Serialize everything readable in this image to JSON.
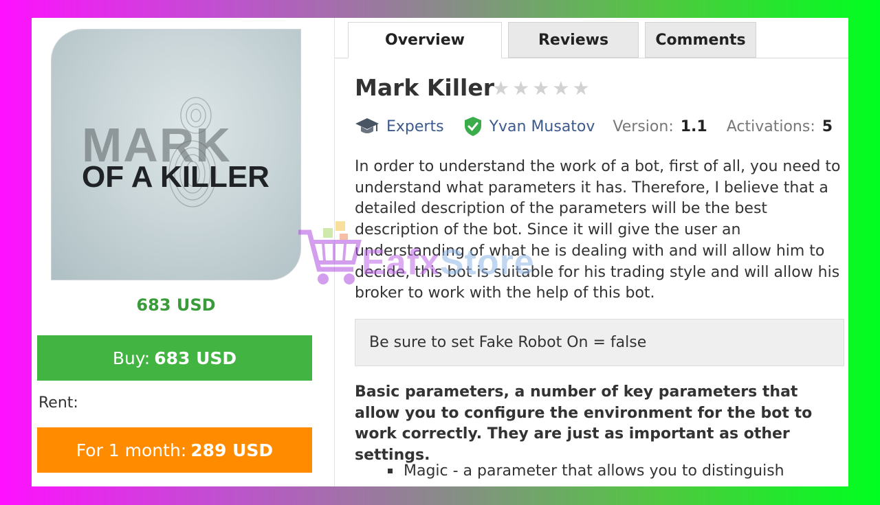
{
  "product": {
    "image_text_line1": "MARK",
    "image_text_line2": "OF A KILLER",
    "price": "683 USD",
    "buy_label": "Buy:",
    "buy_amount": "683 USD",
    "rent_label": "Rent:",
    "rent_period": "For 1 month:",
    "rent_amount": "289 USD"
  },
  "tabs": [
    {
      "label": "Overview",
      "active": true
    },
    {
      "label": "Reviews",
      "active": false
    },
    {
      "label": "Comments",
      "active": false
    }
  ],
  "header": {
    "title": "Mark Killer",
    "rating": 0,
    "rating_max": 5,
    "category": "Experts",
    "author": "Yvan Musatov",
    "version_label": "Version:",
    "version": "1.1",
    "activations_label": "Activations:",
    "activations": "5"
  },
  "content": {
    "description": "In order to understand the work of a bot, first of all, you need to understand what parameters it has. Therefore, I believe that a detailed description of the parameters will be the best description of the bot. Since it will give the user an understanding of what he is dealing with and will allow him to decide, this bot is suitable for his trading style and will allow his broker to work with the help of this bot.",
    "notice": "Be sure to set Fake Robot On = false",
    "basic_params": "Basic parameters, a number of key parameters that allow you to configure the environment for the bot to work correctly. They are just as important as other settings.",
    "bullets": [
      "Magic - a parameter that allows you to distinguish"
    ]
  },
  "watermark": {
    "text_a": "Eafx",
    "text_b": "Store",
    "icon": "shopping-cart-icon"
  },
  "colors": {
    "buy": "#41b441",
    "rent": "#ff8c00",
    "price": "#3a9b3a",
    "link": "#3c5a8c",
    "verified": "#3aad4a"
  }
}
